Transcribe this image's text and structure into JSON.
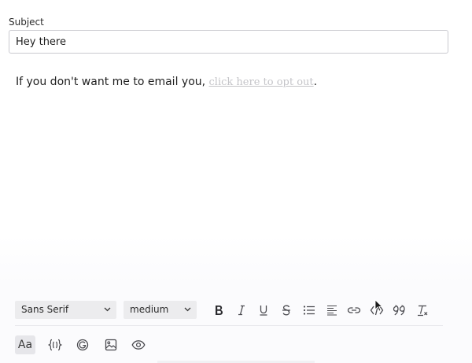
{
  "subject": {
    "label": "Subject",
    "value": "Hey there"
  },
  "body": {
    "text": "If you don't want me to email you, ",
    "link_text": "click here to opt out",
    "suffix": "."
  },
  "toolbar": {
    "font_family": "Sans Serif",
    "font_size": "medium",
    "icons": [
      "bold-icon",
      "italic-icon",
      "underline-icon",
      "strikethrough-icon",
      "bullet-list-icon",
      "align-left-icon",
      "link-icon",
      "code-icon",
      "quote-icon",
      "clear-format-icon"
    ]
  },
  "bottom_bar": {
    "format_label": "Aa",
    "icons": [
      "variables-icon",
      "signature-icon",
      "image-icon",
      "preview-icon"
    ]
  },
  "colors": {
    "link": "#c4c4c8",
    "select_bg": "#ececee",
    "active_bg": "#e6e6ea",
    "icon": "#4a4a4f"
  }
}
